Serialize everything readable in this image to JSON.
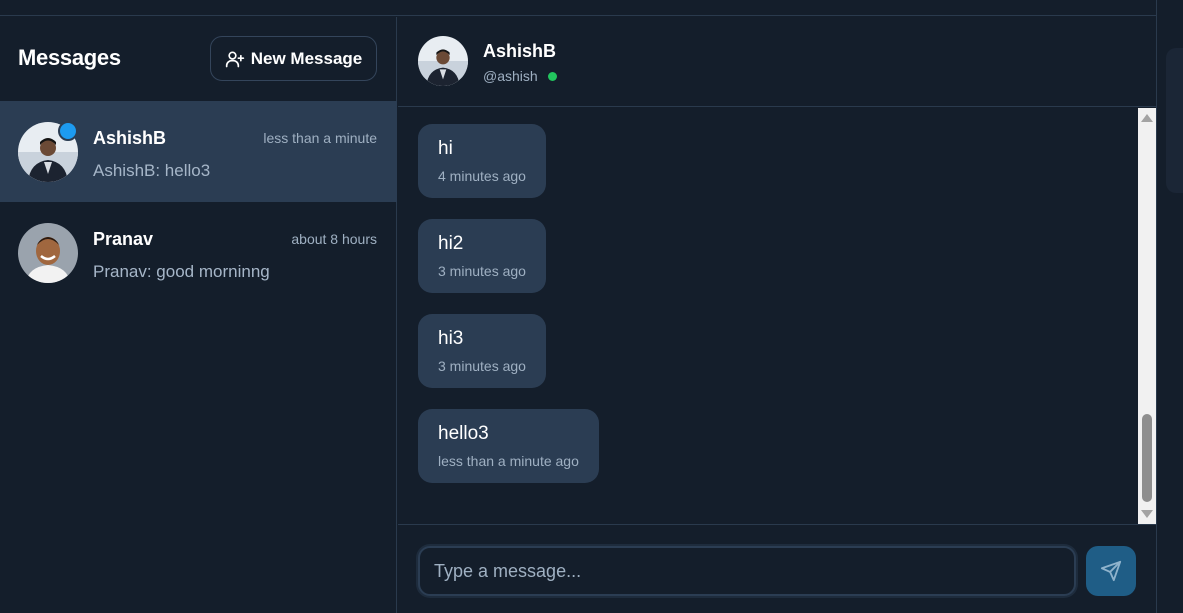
{
  "sidebar": {
    "title": "Messages",
    "new_message_label": "New Message",
    "conversations": [
      {
        "name": "AshishB",
        "time": "less than a minute",
        "preview": "AshishB: hello3",
        "active": true,
        "unread": true
      },
      {
        "name": "Pranav",
        "time": "about 8 hours",
        "preview": "Pranav: good morninng",
        "active": false,
        "unread": false
      }
    ]
  },
  "chat": {
    "header": {
      "name": "AshishB",
      "handle": "@ashish",
      "online": true
    },
    "messages": [
      {
        "text": "hi",
        "time": "4 minutes ago"
      },
      {
        "text": "hi2",
        "time": "3 minutes ago"
      },
      {
        "text": "hi3",
        "time": "3 minutes ago"
      },
      {
        "text": "hello3",
        "time": "less than a minute ago"
      }
    ],
    "composer": {
      "placeholder": "Type a message...",
      "value": ""
    }
  },
  "colors": {
    "background": "#141e2b",
    "active_row": "#2b3d53",
    "bubble": "#2b3d53",
    "unread_dot": "#1d9bf0",
    "online_dot": "#22c55e",
    "send_button": "#1f5d86"
  },
  "icons": {
    "new_message": "user-plus-icon",
    "send": "send-icon"
  }
}
